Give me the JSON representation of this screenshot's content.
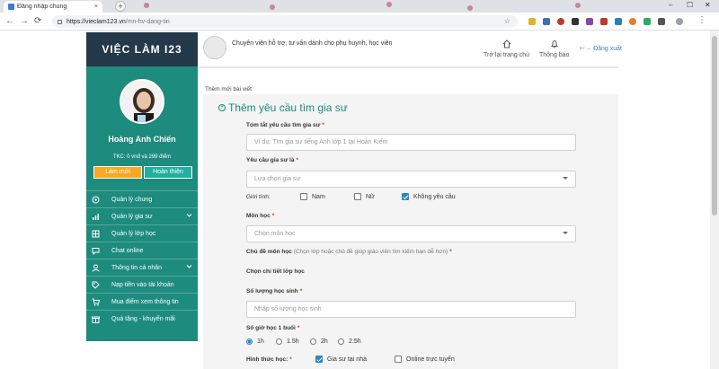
{
  "browser": {
    "tab_title": "Đăng nhập chung",
    "tab_close": "×",
    "new_tab": "+",
    "minimize": "–",
    "maximize": "☐",
    "close": "✕",
    "url_host": "https://vieclam123.vn",
    "url_path": "/mn-hv-dang-tin"
  },
  "sidebar": {
    "brand": "VIỆC LÀM I23",
    "user_name": "Hoàng Anh Chiến",
    "balance": "TKC: 0 vnđ và 299 điểm",
    "btn_new": "Làm mới",
    "btn_complete": "Hoàn thiện",
    "menu": [
      {
        "label": "Quản lý chung",
        "icon": "gear-icon",
        "caret": false
      },
      {
        "label": "Quản lý gia sư",
        "icon": "chart-icon",
        "caret": true
      },
      {
        "label": "Quản lý lớp học",
        "icon": "grid-icon",
        "caret": false
      },
      {
        "label": "Chat online",
        "icon": "chat-icon",
        "caret": false
      },
      {
        "label": "Thông tin cá nhân",
        "icon": "user-icon",
        "caret": true
      },
      {
        "label": "Nạp tiền vào tài khoản",
        "icon": "tag-icon",
        "caret": false
      },
      {
        "label": "Mua điểm xem thông tin",
        "icon": "cart-icon",
        "caret": false
      },
      {
        "label": "Quà tặng - khuyến mãi",
        "icon": "gift-icon",
        "caret": false
      }
    ]
  },
  "header": {
    "tagline": "Chuyên viên hỗ trợ, tư vấn dành cho phụ huynh, học viên",
    "home": "Trở lại trang chủ",
    "notifications": "Thông báo",
    "logout": "Đăng xuất"
  },
  "main": {
    "breadcrumb": "Thêm mới bài viết",
    "title": "Thêm yêu cầu tìm gia sư",
    "required_mark": "*",
    "summary_label": "Tóm tắt yêu cầu tìm gia sư",
    "summary_placeholder": "Ví dụ: Tìm gia sư tiếng Anh lớp 1 tại Hoàn Kiếm",
    "tutor_req_label": "Yêu cầu gia sư là",
    "tutor_req_value": "Lựa chọn gia sư",
    "gender_label": "Giới tính:",
    "gender_options": [
      {
        "label": "Nam",
        "checked": false
      },
      {
        "label": "Nữ",
        "checked": false
      },
      {
        "label": "Không yêu cầu",
        "checked": true
      }
    ],
    "subject_label": "Môn học",
    "subject_value": "Chọn môn học",
    "topic_label": "Chủ đề môn học",
    "topic_hint": "(Chọn lớp hoặc chủ đề giúp giáo viên tìm kiếm bạn dễ hơn)",
    "class_detail_label": "Chọn chi tiết lớp học",
    "students_label": "Số lượng học sinh",
    "students_placeholder": "Nhập số lượng học sinh",
    "hours_label": "Số giờ học 1 buổi",
    "hours_options": [
      {
        "label": "1h",
        "checked": true
      },
      {
        "label": "1.5h",
        "checked": false
      },
      {
        "label": "2h",
        "checked": false
      },
      {
        "label": "2.5h",
        "checked": false
      }
    ],
    "format_label": "Hình thức học:",
    "format_options": [
      {
        "label": "Gia sư tại nhà",
        "checked": true
      },
      {
        "label": "Online trực tuyến",
        "checked": false
      }
    ]
  }
}
